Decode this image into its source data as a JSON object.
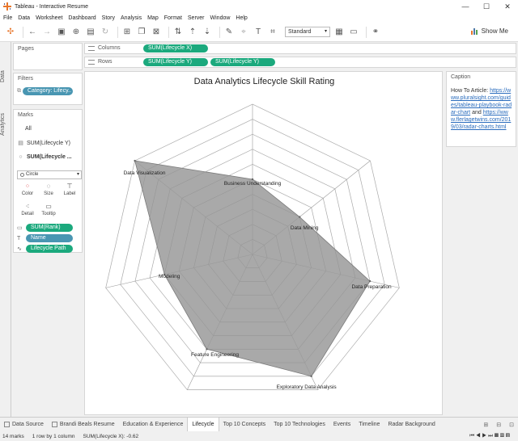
{
  "window": {
    "title": "Tableau - Interactive Resume",
    "controls": [
      "—",
      "☐",
      "✕"
    ]
  },
  "menu": [
    "File",
    "Data",
    "Worksheet",
    "Dashboard",
    "Story",
    "Analysis",
    "Map",
    "Format",
    "Server",
    "Window",
    "Help"
  ],
  "toolbar": {
    "fit_select": "Standard",
    "show_me": "Show Me"
  },
  "side_tabs": {
    "data": "Data",
    "analytics": "Analytics"
  },
  "pages": {
    "label": "Pages"
  },
  "filters": {
    "label": "Filters",
    "pill": "Category: Lifecy.."
  },
  "marks": {
    "label": "Marks",
    "items": [
      "All",
      "SUM(Lifecycle Y)",
      "SUM(Lifecycle ..."
    ],
    "mark_type": "Circle",
    "cards": [
      {
        "label": "Color",
        "icon": "color-icon"
      },
      {
        "label": "Size",
        "icon": "size-icon"
      },
      {
        "label": "Label",
        "icon": "label-icon"
      },
      {
        "label": "Detail",
        "icon": "detail-icon"
      },
      {
        "label": "Tooltip",
        "icon": "tooltip-icon"
      }
    ],
    "encodings": [
      "SUM(Rank)",
      "Name",
      "Lifecycle Path"
    ]
  },
  "shelves": {
    "columns": {
      "label": "Columns",
      "pills": [
        "SUM(Lifecycle X)"
      ]
    },
    "rows": {
      "label": "Rows",
      "pills": [
        "SUM(Lifecycle Y)",
        "SUM(Lifecycle Y)"
      ]
    }
  },
  "caption": {
    "label": "Caption",
    "prefix": "How To Article: ",
    "link1": "https://www.pluralsight.com/guides/tableau-playbook-radar-chart",
    "middle": " and ",
    "link2": "https://www.flerlagetwins.com/2019/03/radar-charts.html"
  },
  "chart_data": {
    "type": "radar",
    "title": "Data Analytics Lifecycle Skill Rating",
    "axes": [
      "Business Understanding",
      "Data Mining",
      "Data Preparation",
      "Exploratory Data Analysis",
      "Feature Engineering",
      "Modeling",
      "Data Visualization"
    ],
    "values": [
      5,
      4,
      8,
      9,
      7,
      6,
      10
    ],
    "max": 10,
    "rings": 10,
    "fill_color": "#a0a0a0",
    "grid": true
  },
  "tabs": [
    "Data Source",
    "Brandi Beals Resume",
    "Education & Experience",
    "Lifecycle",
    "Top 10 Concepts",
    "Top 10 Technologies",
    "Events",
    "Timeline",
    "Radar Background"
  ],
  "active_tab": "Lifecycle",
  "status": {
    "marks": "14 marks",
    "rows": "1 row by 1 column",
    "sum": "SUM(Lifecycle X): -0.62"
  }
}
